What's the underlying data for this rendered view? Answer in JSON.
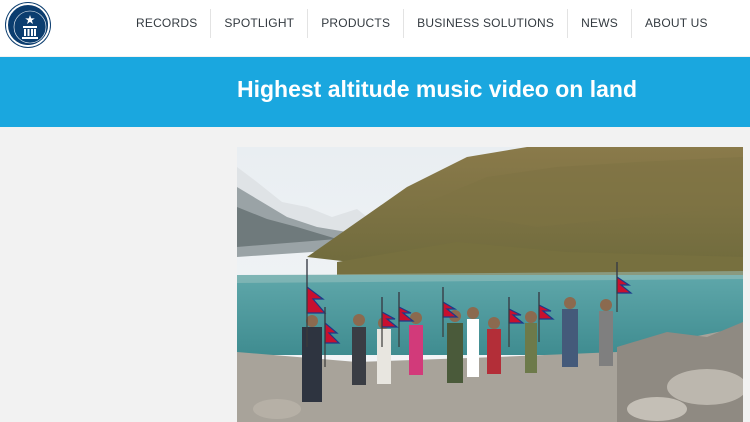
{
  "logo": {
    "icon": "guinness-world-records-logo",
    "text": "GUINNESS WORLD RECORDS"
  },
  "nav": {
    "items": [
      "RECORDS",
      "SPOTLIGHT",
      "PRODUCTS",
      "BUSINESS SOLUTIONS",
      "NEWS",
      "ABOUT US"
    ]
  },
  "banner": {
    "title": "Highest altitude music video on land",
    "color": "#1aa7df"
  },
  "photo": {
    "subject": "photo"
  }
}
